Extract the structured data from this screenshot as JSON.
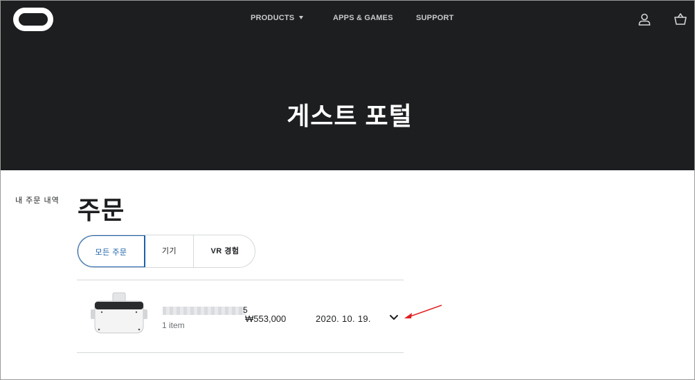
{
  "header": {
    "nav": [
      {
        "label": "PRODUCTS"
      },
      {
        "label": "APPS & GAMES"
      },
      {
        "label": "SUPPORT"
      }
    ],
    "icons": [
      "oculus-logo",
      "user-icon",
      "cart-icon"
    ]
  },
  "hero": {
    "title": "게스트 포털"
  },
  "sidebar": {
    "link": "내 주문 내역"
  },
  "main": {
    "title": "주문",
    "tabs": [
      {
        "label": "모든 주문",
        "active": true
      },
      {
        "label": "기기",
        "active": false
      },
      {
        "label": "VR 경험",
        "active": false
      }
    ],
    "orders": [
      {
        "name_suffix": "5",
        "item_count": "1 item",
        "price": "₩553,000",
        "date": "2020. 10. 19."
      }
    ]
  },
  "colors": {
    "header_bg": "#1c1e20",
    "accent": "#1c5fa8",
    "annotation": "#e02020"
  }
}
